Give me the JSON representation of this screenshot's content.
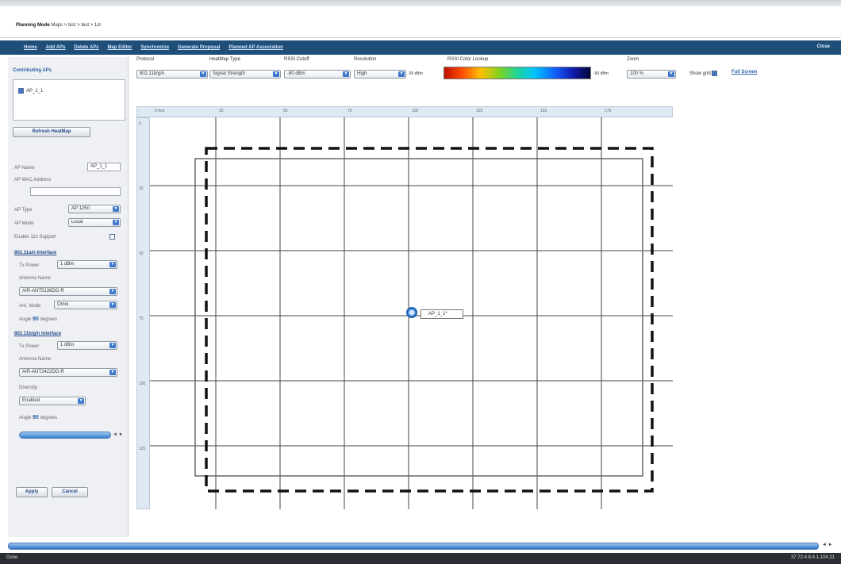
{
  "breadcrumb": {
    "mode": "Planning Mode",
    "path": "Maps > test > test > 1st"
  },
  "nav": {
    "links": [
      "Home",
      "Add APs",
      "Delete APs",
      "Map Editor",
      "Synchronize",
      "Generate Proposal",
      "Planned AP Association"
    ],
    "close": "Close"
  },
  "left_panel": {
    "contributing_title": "Contributing APs",
    "ap_list": [
      "AP_1_1"
    ],
    "refresh_button": "Refresh HeatMap",
    "ap_name_label": "AP Name",
    "ap_name_value": "AP_1_1",
    "ap_mac_label": "AP MAC Address",
    "ap_mac_value": "",
    "ap_type_label": "AP Type",
    "ap_type_value": "AP 1250",
    "ap_mode_label": "AP Mode",
    "ap_mode_value": "Local",
    "enable_11n_label": "Enable 11n Support",
    "iface_a_title": "802.11a/n Interface",
    "tx_power_label": "Tx Power",
    "iface_a_tx_value": "1 dBm",
    "antenna_name_label": "Antenna Name",
    "iface_a_antenna_value": "AIR-ANT5136DG-R",
    "ant_mode_label": "Ant. Mode",
    "ant_mode_value": "Omni",
    "angle_label": "Angle",
    "iface_a_angle": "90",
    "degrees_label": "degrees",
    "iface_b_title": "802.11b/g/n Interface",
    "iface_b_tx_value": "1 dBm",
    "iface_b_antenna_value": "AIR-ANT2422DG-R",
    "diversity_label": "Diversity",
    "diversity_value": "Enabled",
    "iface_b_angle": "90",
    "slider_arrows": "◄ ►",
    "apply_button": "Apply",
    "cancel_button": "Cancel"
  },
  "toolbar": {
    "protocol_label": "Protocol",
    "protocol_value": "802.11b/g/n",
    "heatmap_label": "HeatMap Type",
    "heatmap_value": "Signal Strength",
    "rssi_label": "RSSI Cutoff",
    "rssi_value": "-80 dBm",
    "resolution_label": "Resolution",
    "resolution_value": "High",
    "color_lookup_label": "RSSI Color Lookup",
    "color_min": "-35 dBm",
    "color_max": "-90 dBm",
    "zoom_label": "Zoom",
    "zoom_value": "100 %",
    "show_grid_label": "Show grid",
    "show_grid_checked": true,
    "full_screen_link": "Full Screen"
  },
  "map": {
    "ruler_top": [
      "0 feet",
      "25",
      "50",
      "75",
      "100",
      "125",
      "150",
      "175"
    ],
    "ruler_left": [
      "0",
      "25",
      "50",
      "75",
      "100",
      "125"
    ],
    "ap_label": "AP_1_1*"
  },
  "status": {
    "left": "Done",
    "right": "37.72.4.8.4.1.104.21"
  }
}
